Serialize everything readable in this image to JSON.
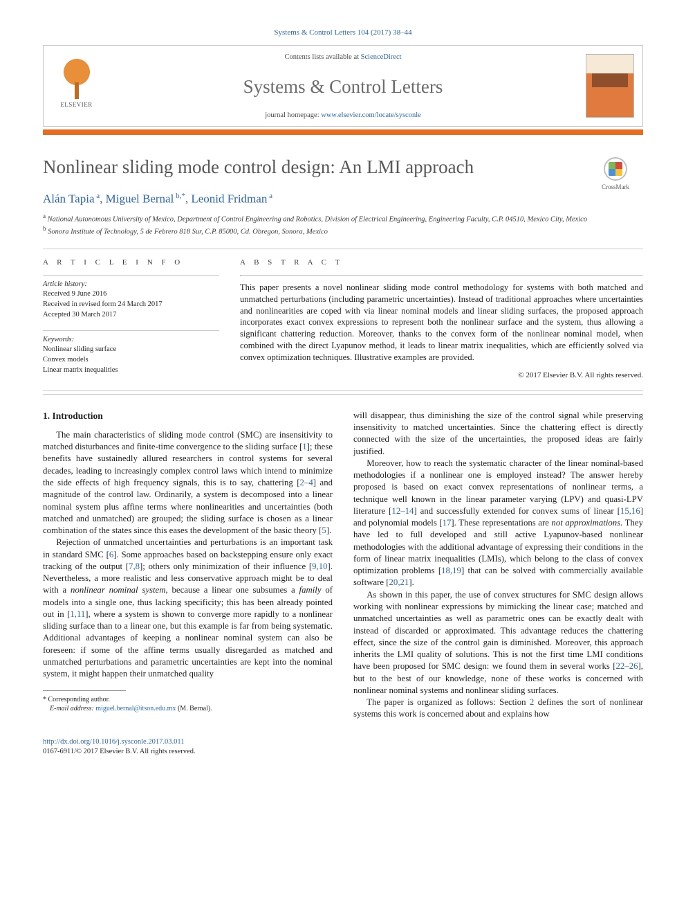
{
  "journal_ref": "Systems & Control Letters 104 (2017) 38–44",
  "banner": {
    "contents_prefix": "Contents lists available at ",
    "contents_link": "ScienceDirect",
    "journal_name": "Systems & Control Letters",
    "homepage_prefix": "journal homepage: ",
    "homepage_link": "www.elsevier.com/locate/sysconle",
    "publisher_word": "ELSEVIER"
  },
  "crossmark_label": "CrossMark",
  "title": "Nonlinear sliding mode control design: An LMI approach",
  "authors_html": "Alán Tapia|a|, Miguel Bernal|b,*|, Leonid Fridman|a|",
  "authors": [
    {
      "name": "Alán Tapia",
      "sup": "a"
    },
    {
      "name": "Miguel Bernal",
      "sup": "b,*"
    },
    {
      "name": "Leonid Fridman",
      "sup": "a"
    }
  ],
  "affiliations": [
    {
      "sup": "a",
      "text": "National Autonomous University of Mexico, Department of Control Engineering and Robotics, Division of Electrical Engineering, Engineering Faculty, C.P. 04510, Mexico City, Mexico"
    },
    {
      "sup": "b",
      "text": "Sonora Institute of Technology, 5 de Febrero 818 Sur, C.P. 85000, Cd. Obregon, Sonora, Mexico"
    }
  ],
  "labels": {
    "article_info": "A R T I C L E   I N F O",
    "abstract": "A B S T R A C T",
    "article_history": "Article history:",
    "keywords": "Keywords:"
  },
  "article_history": [
    "Received 9 June 2016",
    "Received in revised form 24 March 2017",
    "Accepted 30 March 2017"
  ],
  "keywords": [
    "Nonlinear sliding surface",
    "Convex models",
    "Linear matrix inequalities"
  ],
  "abstract": "This paper presents a novel nonlinear sliding mode control methodology for systems with both matched and unmatched perturbations (including parametric uncertainties). Instead of traditional approaches where uncertainties and nonlinearities are coped with via linear nominal models and linear sliding surfaces, the proposed approach incorporates exact convex expressions to represent both the nonlinear surface and the system, thus allowing a significant chattering reduction. Moreover, thanks to the convex form of the nonlinear nominal model, when combined with the direct Lyapunov method, it leads to linear matrix inequalities, which are efficiently solved via convex optimization techniques. Illustrative examples are provided.",
  "copyright": "© 2017 Elsevier B.V. All rights reserved.",
  "section1_heading": "1. Introduction",
  "paragraphs": {
    "p1": "The main characteristics of sliding mode control (SMC) are insensitivity to matched disturbances and finite-time convergence to the sliding surface [1]; these benefits have sustainedly allured researchers in control systems for several decades, leading to increasingly complex control laws which intend to minimize the side effects of high frequency signals, this is to say, chattering [2–4] and magnitude of the control law. Ordinarily, a system is decomposed into a linear nominal system plus affine terms where nonlinearities and uncertainties (both matched and unmatched) are grouped; the sliding surface is chosen as a linear combination of the states since this eases the development of the basic theory [5].",
    "p2a": "Rejection of unmatched uncertainties and perturbations is an important task in standard SMC [6]. Some approaches based on backstepping ensure only exact tracking of the output [7,8]; others only minimization of their influence [9,10]. Nevertheless, a more realistic and less conservative approach might be to deal with a ",
    "p2_em": "nonlinear nominal system",
    "p2b": ", because a linear one subsumes a ",
    "p2_em2": "family",
    "p2c": " of models into a single one, thus lacking specificity; this has been already pointed out in [1,11], where a system is shown to converge more rapidly to a nonlinear sliding surface than to a linear one, but this example is far from being systematic. Additional advantages of keeping a nonlinear nominal system can also be foreseen: if some of the affine terms usually disregarded as matched and unmatched perturbations and parametric uncertainties are kept into the nominal system, it might happen their unmatched quality",
    "p2d": "will disappear, thus diminishing the size of the control signal while preserving insensitivity to matched uncertainties. Since the chattering effect is directly connected with the size of the uncertainties, the proposed ideas are fairly justified.",
    "p3a": "Moreover, how to reach the systematic character of the linear nominal-based methodologies if a nonlinear one is employed instead? The answer hereby proposed is based on exact convex representations of nonlinear terms, a technique well known in the linear parameter varying (LPV) and quasi-LPV literature [12–14] and successfully extended for convex sums of linear [15,16] and polynomial models [17]. These representations are ",
    "p3_em": "not approximations",
    "p3b": ". They have led to full developed and still active Lyapunov-based nonlinear methodologies with the additional advantage of expressing their conditions in the form of linear matrix inequalities (LMIs), which belong to the class of convex optimization problems [18,19] that can be solved with commercially available software [20,21].",
    "p4": "As shown in this paper, the use of convex structures for SMC design allows working with nonlinear expressions by mimicking the linear case; matched and unmatched uncertainties as well as parametric ones can be exactly dealt with instead of discarded or approximated. This advantage reduces the chattering effect, since the size of the control gain is diminished. Moreover, this approach inherits the LMI quality of solutions. This is not the first time LMI conditions have been proposed for SMC design: we found them in several works [22–26], but to the best of our knowledge, none of these works is concerned with nonlinear nominal systems and nonlinear sliding surfaces.",
    "p5": "The paper is organized as follows: Section 2 defines the sort of nonlinear systems this work is concerned about and explains how"
  },
  "refs": {
    "r1": "1",
    "r2_4": "2–4",
    "r5": "5",
    "r6": "6",
    "r7_8": "7,8",
    "r9_10": "9,10",
    "r1_11": "1,11",
    "r12_14": "12–14",
    "r15_16": "15,16",
    "r17": "17",
    "r18_19": "18,19",
    "r20_21": "20,21",
    "r22_26": "22–26",
    "sec2": "2"
  },
  "footnote": {
    "star": "* Corresponding author.",
    "email_label": "E-mail address: ",
    "email": "miguel.bernal@itson.edu.mx",
    "email_suffix": " (M. Bernal)."
  },
  "bottom": {
    "doi": "http://dx.doi.org/10.1016/j.sysconle.2017.03.011",
    "issn_line": "0167-6911/© 2017 Elsevier B.V. All rights reserved."
  }
}
